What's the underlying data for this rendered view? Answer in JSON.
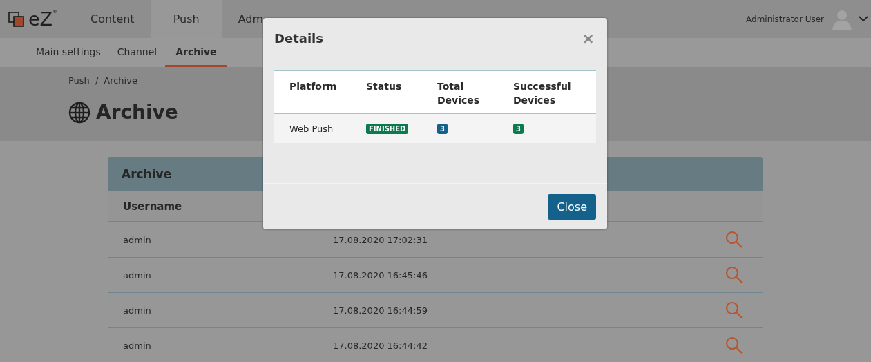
{
  "top_nav": {
    "logo": "eZ$^{®}$",
    "tabs": [
      {
        "label": "Content",
        "selected": false
      },
      {
        "label": "Push",
        "selected": true
      },
      {
        "label": "Adm",
        "selected": false
      }
    ],
    "user": "Administrator User"
  },
  "sub_nav": [
    {
      "label": "Main settings",
      "selected": false
    },
    {
      "label": "Channel",
      "selected": false
    },
    {
      "label": "Archive",
      "selected": true
    }
  ],
  "breadcrumb": {
    "items": [
      "Push",
      "Archive"
    ],
    "separator": "/"
  },
  "page_title": "Archive",
  "panel": {
    "title": "Archive",
    "columns": [
      "Username"
    ],
    "rows": [
      {
        "username": "admin",
        "date": "17.08.2020 17:02:31"
      },
      {
        "username": "admin",
        "date": "17.08.2020 16:45:46"
      },
      {
        "username": "admin",
        "date": "17.08.2020 16:44:59"
      },
      {
        "username": "admin",
        "date": "17.08.2020 16:44:42"
      }
    ]
  },
  "modal": {
    "title": "Details",
    "close_symbol": "×",
    "columns": [
      "Platform",
      "Status",
      "Total Devices",
      "Successful Devices"
    ],
    "rows": [
      {
        "platform": "Web Push",
        "status": {
          "text": "FINISHED",
          "color": "#0b7a4f"
        },
        "total": {
          "text": "3",
          "color": "#14628b"
        },
        "successful": {
          "text": "3",
          "color": "#0b7a4f"
        }
      }
    ],
    "button": "Close"
  }
}
